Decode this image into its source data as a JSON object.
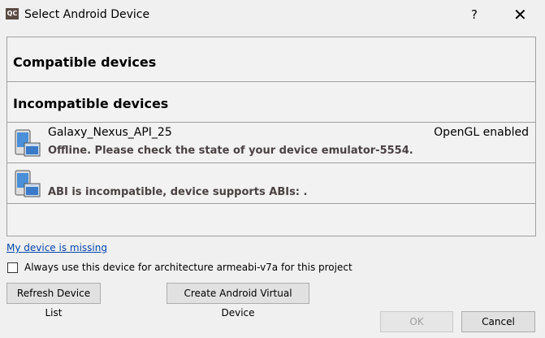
{
  "window": {
    "title": "Select Android Device",
    "icon_text": "QC",
    "help": "?",
    "close": "✕"
  },
  "list": {
    "compatible_header": "Compatible devices",
    "incompatible_header": "Incompatible devices",
    "devices": [
      {
        "name": "Galaxy_Nexus_API_25",
        "status": "OpenGL enabled",
        "message": "Offline. Please check the state of your device emulator-5554."
      },
      {
        "name": "",
        "status": "",
        "message": "ABI is incompatible, device supports ABIs: ."
      }
    ]
  },
  "link": "My device is missing",
  "checkbox": {
    "label": "Always use this device for architecture armeabi-v7a for this project",
    "checked": false
  },
  "buttons": {
    "refresh": "Refresh Device List",
    "create": "Create Android Virtual Device",
    "ok": "OK",
    "cancel": "Cancel"
  }
}
